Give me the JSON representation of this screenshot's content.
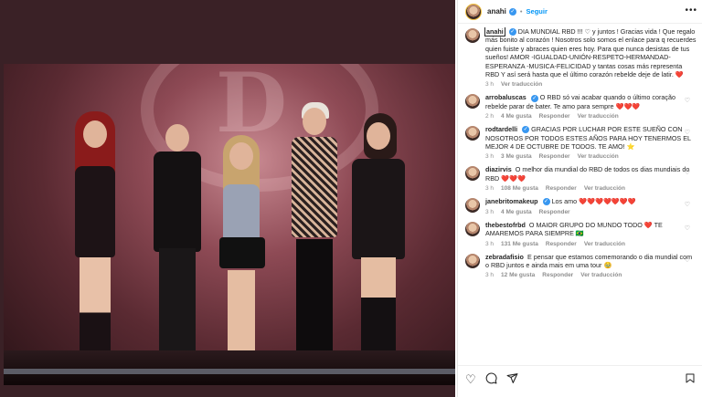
{
  "post": {
    "username": "anahi",
    "verified_mark": "✓",
    "separator": "•",
    "follow_label": "Seguir",
    "more_icon": "more-options-icon"
  },
  "caption": {
    "username": "anahi",
    "verified_mark": "✓",
    "text": " DIA MUNDIAL RBD !!! ♡ y juntos ! Gracias vida ! Que regalo más bonito al corazón ! Nosotros solo somos el enlace para q recuerdes quien fuiste y abraces quien eres hoy. Para que nunca desistas de tus sueños! AMOR -IGUALDAD-UNIÓN-RESPETO-HERMANDAD-ESPERANZA -MUSICA-FELICIDAD y tantas cosas más representa RBD Y así será hasta que el último corazón rebelde deje de latir. ",
    "heart": "❤️",
    "time": "3 h",
    "translate": "Ver traducción"
  },
  "comments": [
    {
      "username": "arrobaluscas",
      "verified": true,
      "text": "O RBD só vai acabar quando o último coração rebelde parar de bater. Te amo para sempre ",
      "emoji": "❤️❤️❤️",
      "time": "2 h",
      "likes": "4 Me gusta",
      "reply": "Responder",
      "translate": "Ver traducción"
    },
    {
      "username": "rodtardelli",
      "verified": true,
      "text": "GRACIAS POR LUCHAR POR ESTE SUEÑO CON NOSOTROS POR TODOS ESTES AÑOS PARA HOY TENERMOS EL MEJOR 4 DE OCTUBRE DE TODOS. TE AMO! ",
      "emoji": "⭐",
      "time": "3 h",
      "likes": "3 Me gusta",
      "reply": "Responder",
      "translate": "Ver traducción"
    },
    {
      "username": "diazirvis",
      "verified": false,
      "text": "O melhor dia mundial do RBD de todos os dias mundiais do RBD ",
      "emoji": "❤️❤️❤️",
      "time": "3 h",
      "likes": "108 Me gusta",
      "reply": "Responder",
      "translate": "Ver traducción"
    },
    {
      "username": "janebritomakeup",
      "verified": true,
      "text": "Los amo",
      "emoji": "❤️❤️❤️❤️❤️❤️❤️",
      "time": "3 h",
      "likes": "4 Me gusta",
      "reply": "Responder",
      "translate": "",
      "time_only": true
    },
    {
      "username": "thebestofrbd",
      "verified": false,
      "text": "O MAIOR GRUPO DO MUNDO TODO ",
      "emoji": "❤️",
      "text2": " TE AMAREMOS PARA SIEMPRE ",
      "emoji2": "🇧🇷",
      "time": "3 h",
      "likes": "131 Me gusta",
      "reply": "Responder",
      "translate": "Ver traducción"
    },
    {
      "username": "zebradafisio",
      "verified": false,
      "text": "E pensar que estamos comemorando o dia mundial com o RBD juntos e ainda mais em uma tour ",
      "emoji": "🥹",
      "time": "3 h",
      "likes": "12 Me gusta",
      "reply": "Responder",
      "translate": "Ver traducción"
    }
  ],
  "actions": {
    "like_icon": "heart-outline-icon",
    "comment_icon": "comment-bubble-icon",
    "share_icon": "paper-plane-icon",
    "save_icon": "bookmark-icon"
  },
  "photo": {
    "stage_letter": "D"
  },
  "colors": {
    "link_blue": "#0095f6",
    "verified_blue": "#3897f0",
    "heart_red": "#ed4956",
    "meta_gray": "#8e8e8e"
  }
}
